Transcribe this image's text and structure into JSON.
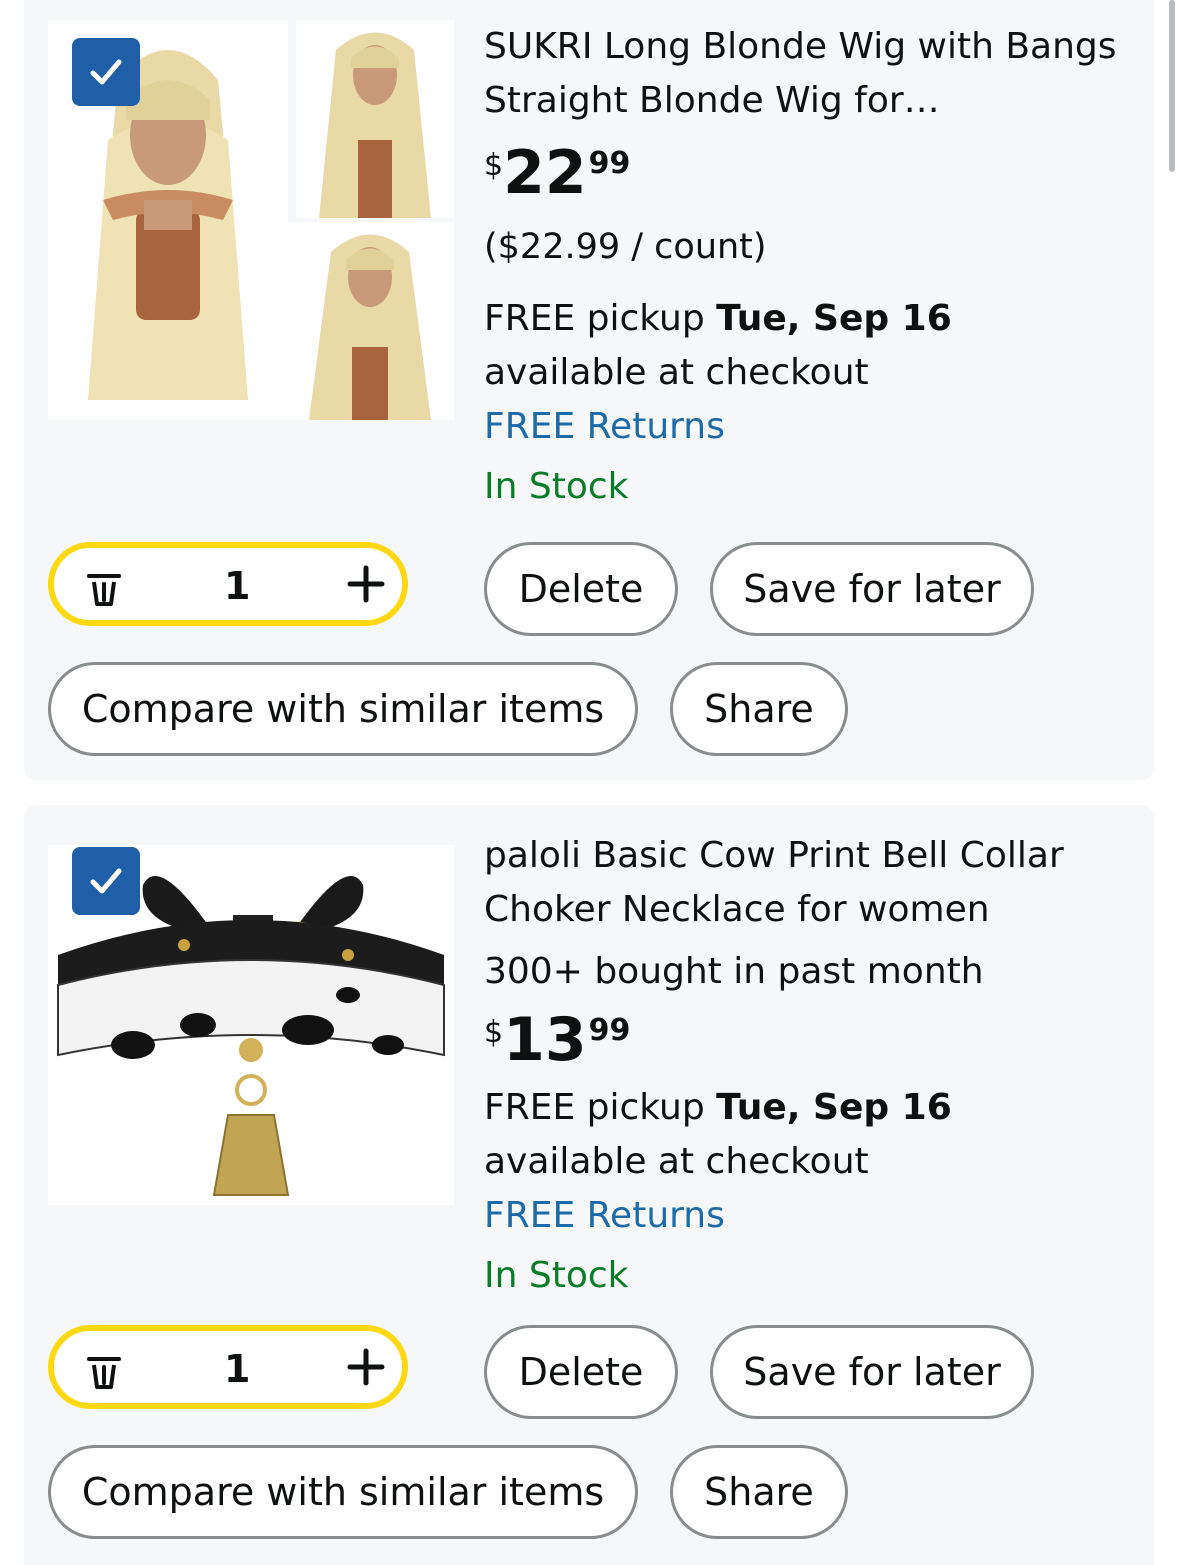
{
  "items": [
    {
      "title": "SUKRI Long Blonde Wig with Bangs Straight Blonde Wig for…",
      "price_currency": "$",
      "price_whole": "22",
      "price_fraction": "99",
      "unit_price": "($22.99 / count)",
      "pickup_prefix": "FREE pickup ",
      "pickup_date": "Tue, Sep 16",
      "pickup_suffix": "available at checkout",
      "returns": "FREE Returns",
      "stock": "In Stock",
      "quantity": "1",
      "delete_label": "Delete",
      "save_label": "Save for later",
      "compare_label": "Compare with similar items",
      "share_label": "Share",
      "checked": true
    },
    {
      "title": "paloli Basic Cow Print Bell Collar Choker Necklace for women",
      "bought": "300+ bought in past month",
      "price_currency": "$",
      "price_whole": "13",
      "price_fraction": "99",
      "pickup_prefix": "FREE pickup ",
      "pickup_date": "Tue, Sep 16",
      "pickup_suffix": "available at checkout",
      "returns": "FREE Returns",
      "stock": "In Stock",
      "quantity": "1",
      "delete_label": "Delete",
      "save_label": "Save for later",
      "compare_label": "Compare with similar items",
      "share_label": "Share",
      "checked": true
    }
  ],
  "colors": {
    "accent_blue": "#1e5fa8",
    "link_blue": "#1d6aa9",
    "stock_green": "#0b7c2a",
    "qty_border": "#ffd814"
  }
}
